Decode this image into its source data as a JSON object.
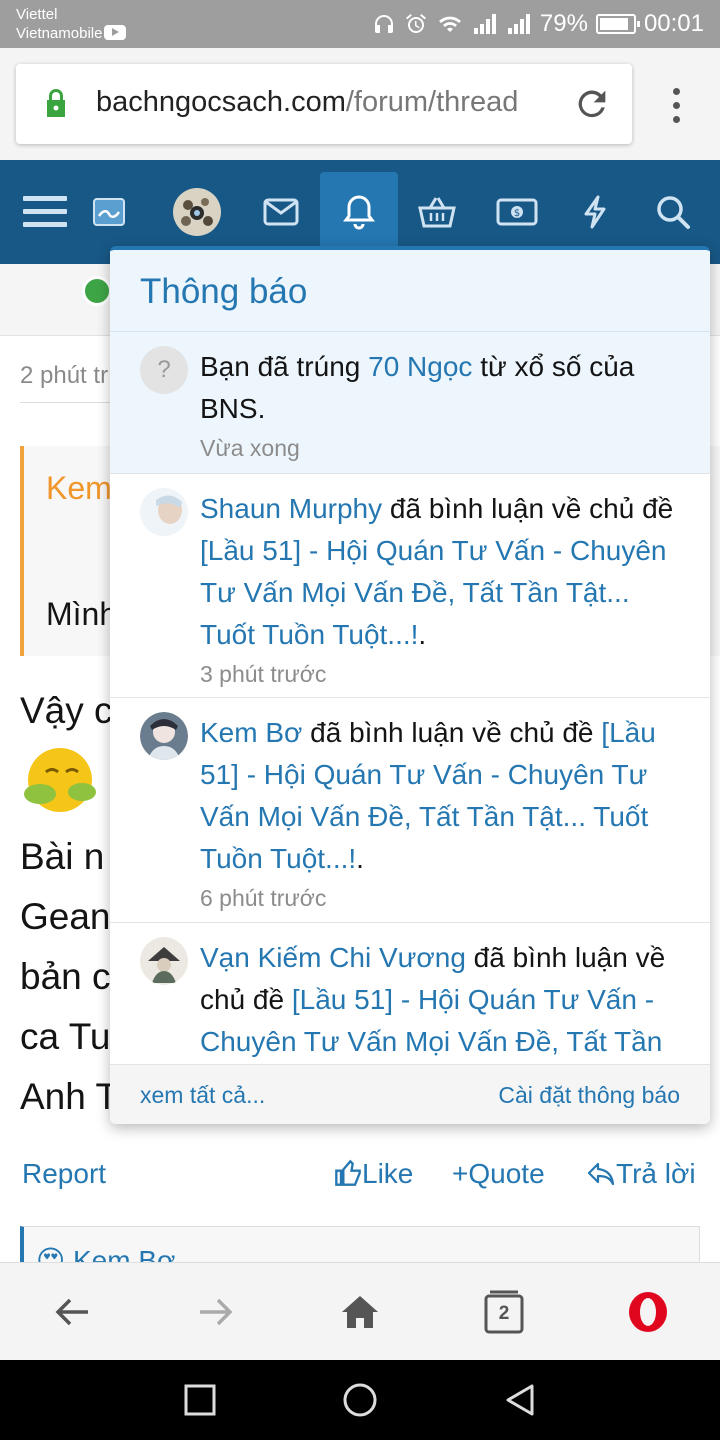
{
  "status_bar": {
    "carrier1": "Viettel",
    "carrier2": "Vietnamobile",
    "battery": "79%",
    "time": "00:01"
  },
  "browser": {
    "url_domain": "bachngocsach.com",
    "url_path": "/forum/thread",
    "tab_count": "2"
  },
  "nav": {
    "icons": [
      "menu-icon",
      "logo-icon",
      "avatar",
      "mail-icon",
      "bell-icon",
      "shop-icon",
      "money-icon",
      "bolt-icon",
      "search-icon"
    ],
    "active": "bell-icon"
  },
  "background_page": {
    "post_time": "2 phút tr",
    "quote_author": "Kem",
    "quote_text": "Mình",
    "lines": [
      "Vậy c",
      "Bài n",
      "Gean",
      "bản c",
      "ca Tu",
      "Anh T"
    ],
    "actions": {
      "report": "Report",
      "like": "Like",
      "quote": "Quote",
      "reply": "Trả lời"
    },
    "next_post_author": "Kem Bơ"
  },
  "notifications": {
    "title": "Thông báo",
    "items": [
      {
        "avatar": "question-avatar",
        "text_before": "Bạn đã trúng ",
        "link": "70 Ngọc",
        "text_after": " từ xổ số của BNS.",
        "time": "Vừa xong",
        "unread": true
      },
      {
        "user": "Shaun Murphy",
        "action": " đã bình luận về chủ đề ",
        "thread": "[Lầu 51] - Hội Quán Tư Vấn - Chuyên Tư Vấn Mọi Vấn Đề, Tất Tần Tật... Tuốt Tuồn Tuột...!",
        "end": ".",
        "time": "3 phút trước"
      },
      {
        "user": "Kem Bơ",
        "action": " đã bình luận về chủ đề ",
        "thread": "[Lầu 51] - Hội Quán Tư Vấn - Chuyên Tư Vấn Mọi Vấn Đề, Tất Tần Tật... Tuốt Tuồn Tuột...!",
        "end": ".",
        "time": "6 phút trước"
      },
      {
        "user": "Vạn Kiếm Chi Vương",
        "action": " đã bình luận về chủ đề ",
        "thread": "[Lầu 51] - Hội Quán Tư Vấn - Chuyên Tư Vấn Mọi Vấn Đề, Tất Tần",
        "end": ""
      }
    ],
    "footer_left": "xem tất cả...",
    "footer_right": "Cài đặt thông báo"
  },
  "colors": {
    "nav_bg": "#185886",
    "accent": "#2577b1",
    "quote_accent": "#f0a33b"
  }
}
